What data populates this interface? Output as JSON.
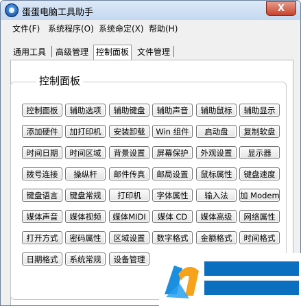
{
  "window": {
    "title": "蛋蛋电脑工具助手",
    "close_label": "X"
  },
  "menu": [
    {
      "label": "文件(F)"
    },
    {
      "label": "系统程序(O)"
    },
    {
      "label": "系统命定(X)"
    },
    {
      "label": "帮助(H)"
    }
  ],
  "tabs": [
    {
      "label": "通用工具",
      "active": false
    },
    {
      "label": "高级管理",
      "active": false
    },
    {
      "label": "控制面板",
      "active": true
    },
    {
      "label": "文件管理",
      "active": false
    }
  ],
  "panel": {
    "title": "控制面板"
  },
  "buttons": [
    [
      "控制面板",
      "辅助选项",
      "辅助键盘",
      "辅助声音",
      "辅助鼠标",
      "辅助显示"
    ],
    [
      "添加硬件",
      "加打印机",
      "安装卸载",
      "Win 组件",
      "启动盘",
      "复制软盘"
    ],
    [
      "时间日期",
      "时间区域",
      "背景设置",
      "屏幕保护",
      "外观设置",
      "显示器"
    ],
    [
      "拨号连接",
      "操纵杆",
      "邮件传真",
      "邮局设置",
      "鼠标属性",
      "键盘速度"
    ],
    [
      "键盘语言",
      "键盘常规",
      "打印机",
      "字体属性",
      "输入法",
      "加 Modem"
    ],
    [
      "媒体声音",
      "媒体视频",
      "媒体MIDI",
      "媒体 CD",
      "媒体高级",
      "网络属性"
    ],
    [
      "打开方式",
      "密码属性",
      "区域设置",
      "数字格式",
      "金额格式",
      "时间格式"
    ],
    [
      "日期格式",
      "系统常规",
      "设备管理",
      "",
      "",
      ""
    ]
  ],
  "colors": {
    "watermark_blue": "#0a6fbf",
    "watermark_logo_orange": "#f7a21b",
    "watermark_logo_blue": "#1a8fe0"
  },
  "icons": {
    "app": "app-logo-icon",
    "watermark": "site-logo-icon"
  }
}
